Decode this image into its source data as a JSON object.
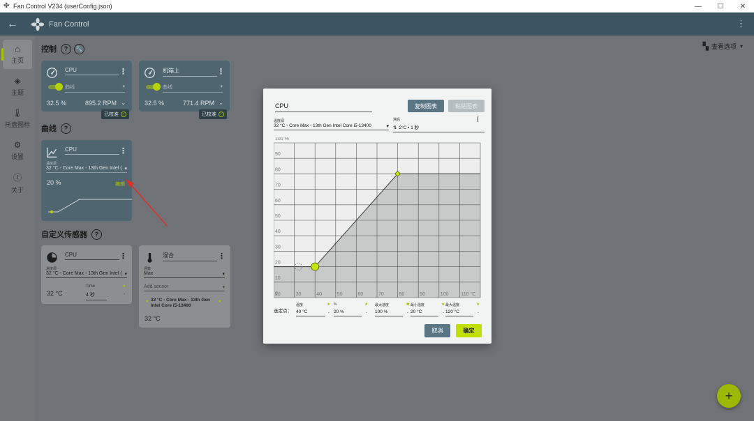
{
  "window": {
    "title": "Fan Control V234 (userConfig.json)",
    "minimize": "—",
    "maximize": "☐",
    "close": "✕"
  },
  "appbar": {
    "name": "Fan Control",
    "back": "←",
    "more": "⋮"
  },
  "nav": [
    {
      "label": "主页",
      "icon": "⌂"
    },
    {
      "label": "主题",
      "icon": "◈"
    },
    {
      "label": "托盘图标",
      "icon": "🌡"
    },
    {
      "label": "设置",
      "icon": "⚙"
    },
    {
      "label": "关于",
      "icon": "ⓘ"
    }
  ],
  "view_options": {
    "label": "查看选项",
    "caret": "▾"
  },
  "sections": {
    "controls": "控制",
    "curves": "曲线",
    "custom_sensors": "自定义传感器",
    "help": "?"
  },
  "controls": [
    {
      "name": "CPU",
      "curve": "曲线",
      "percent": "32.5 %",
      "rpm": "895.2 RPM",
      "calibrated": "已校准",
      "enabled": true
    },
    {
      "name": "机箱上",
      "curve": "曲线",
      "percent": "32.5 %",
      "rpm": "771.4 RPM",
      "calibrated": "已校准",
      "enabled": true
    }
  ],
  "curve_card": {
    "name": "CPU",
    "source_label": "温度源",
    "source": "32 °C - Core Max - 13th Gen Intel (",
    "percent": "20 %",
    "edit": "编辑"
  },
  "custom_sensors": [
    {
      "name": "CPU",
      "source_label": "温度源",
      "source": "32 °C - Core Max - 13th Gen Intel (",
      "time_label": "Time",
      "time": "4 秒",
      "value": "32 °C"
    },
    {
      "name": "混合",
      "func_label": "函数",
      "func": "Max",
      "add": "Add sensor",
      "sensor": "32 °C - Core Max - 13th Gen Intel Core i5-13400",
      "value": "32 °C"
    }
  ],
  "dialog": {
    "name": "CPU",
    "copy": "复制图表",
    "paste": "粘贴图表",
    "source_label": "温度源",
    "source": "32 °C - Core Max - 13th Gen Intel Core i5-13400",
    "hysteresis_label": "滞后",
    "hysteresis": "2°C • 1 秒",
    "points_label": "选定点：",
    "cancel": "取消",
    "ok": "确定",
    "fields": [
      {
        "label": "温度",
        "value": "40 °C"
      },
      {
        "label": "%",
        "value": "20 %"
      },
      {
        "label": "最大速度",
        "value": "100 %"
      },
      {
        "label": "最小温度",
        "value": "20 °C"
      },
      {
        "label": "最大温度",
        "value": "120 °C"
      }
    ]
  },
  "chart_data": {
    "type": "line",
    "x_ticks": [
      "20",
      "30",
      "40",
      "50",
      "60",
      "70",
      "80",
      "90",
      "100",
      "110 °C"
    ],
    "y_ticks": [
      "0",
      "10",
      "20",
      "30",
      "40",
      "50",
      "60",
      "70",
      "80",
      "90",
      "100 %"
    ],
    "xlim": [
      20,
      120
    ],
    "ylim": [
      0,
      100
    ],
    "points": [
      {
        "x": 20,
        "y": 20
      },
      {
        "x": 40,
        "y": 20
      },
      {
        "x": 80,
        "y": 80
      },
      {
        "x": 120,
        "y": 80
      }
    ],
    "selected_point": {
      "x": 40,
      "y": 20
    },
    "current_temp_marker": {
      "x": 32,
      "y": 20
    },
    "colors": {
      "fill": "#c8caca",
      "line": "#3a3a3a",
      "grid": "#555555",
      "point": "#c6e800",
      "bg": "#eeeeee"
    }
  },
  "fab": "+"
}
